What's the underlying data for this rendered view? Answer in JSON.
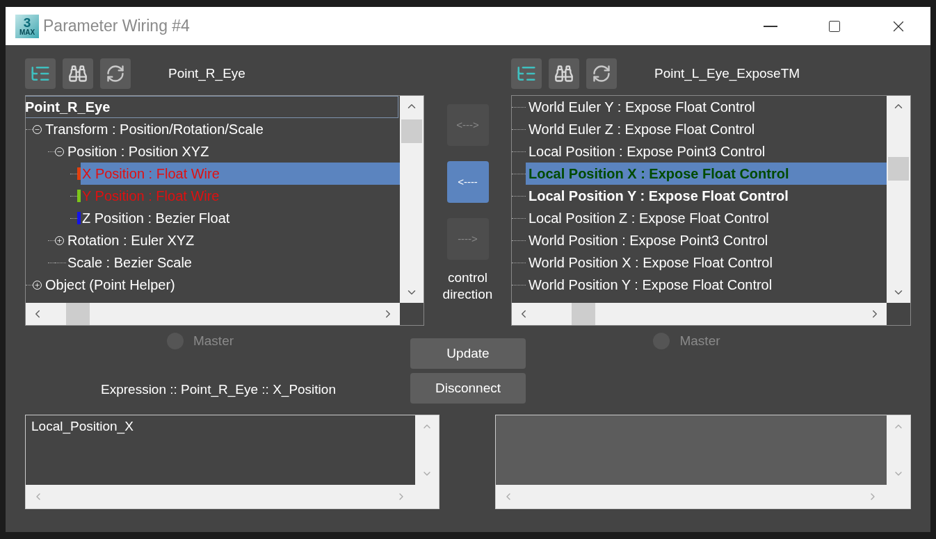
{
  "window": {
    "title": "Parameter Wiring #4",
    "logo": {
      "digit": "3",
      "sub": "MAX"
    }
  },
  "left": {
    "object": "Point_R_Eye",
    "tree": [
      {
        "label": "Point_R_Eye",
        "kind": "root",
        "selected": false,
        "children": [
          {
            "label": "Transform : Position/Rotation/Scale",
            "kind": "plain",
            "selected": false,
            "expanded": true,
            "children": [
              {
                "label": "Position : Position XYZ",
                "kind": "plain",
                "selected": false,
                "expanded": true,
                "children": [
                  {
                    "label": "X Position : Float Wire",
                    "kind": "wired",
                    "selected": true,
                    "color": "#e0400f"
                  },
                  {
                    "label": "Y Position : Float Wire",
                    "kind": "wired",
                    "selected": false,
                    "color": "#7cc41a"
                  },
                  {
                    "label": "Z Position : Bezier Float",
                    "kind": "plain",
                    "selected": false,
                    "color": "#1414e6"
                  }
                ]
              },
              {
                "label": "Rotation : Euler XYZ",
                "kind": "plain",
                "selected": false,
                "expanded": false
              },
              {
                "label": "Scale : Bezier Scale",
                "kind": "plain",
                "selected": false
              }
            ]
          },
          {
            "label": "Object (Point Helper)",
            "kind": "plain",
            "selected": false,
            "expanded": false
          }
        ]
      }
    ],
    "master": {
      "label": "Master",
      "checked": false,
      "disabled": true
    }
  },
  "right": {
    "object": "Point_L_Eye_ExposeTM",
    "items": [
      {
        "label": "World Euler Y : Expose Float Control",
        "kind": "plain",
        "selected": false
      },
      {
        "label": "World Euler Z : Expose Float Control",
        "kind": "plain",
        "selected": false
      },
      {
        "label": "Local Position : Expose Point3 Control",
        "kind": "plain",
        "selected": false
      },
      {
        "label": "Local Position X : Expose Float Control",
        "kind": "linked",
        "selected": true
      },
      {
        "label": "Local Position Y : Expose Float Control",
        "kind": "bold",
        "selected": false
      },
      {
        "label": "Local Position Z : Expose Float Control",
        "kind": "plain",
        "selected": false
      },
      {
        "label": "World Position : Expose Point3 Control",
        "kind": "plain",
        "selected": false
      },
      {
        "label": "World Position X : Expose Float Control",
        "kind": "plain",
        "selected": false
      },
      {
        "label": "World Position Y : Expose Float Control",
        "kind": "plain",
        "selected": false
      }
    ],
    "master": {
      "label": "Master",
      "checked": false,
      "disabled": true
    }
  },
  "direction": {
    "buttons": [
      {
        "label": "<--->",
        "selected": false
      },
      {
        "label": "<----",
        "selected": true
      },
      {
        "label": "---->",
        "selected": false
      }
    ],
    "caption": "control direction"
  },
  "actions": [
    "Update",
    "Disconnect"
  ],
  "expression": {
    "label": "Expression :: Point_R_Eye :: X_Position",
    "value": "Local_Position_X"
  },
  "expression_right": {
    "disabled": true
  }
}
